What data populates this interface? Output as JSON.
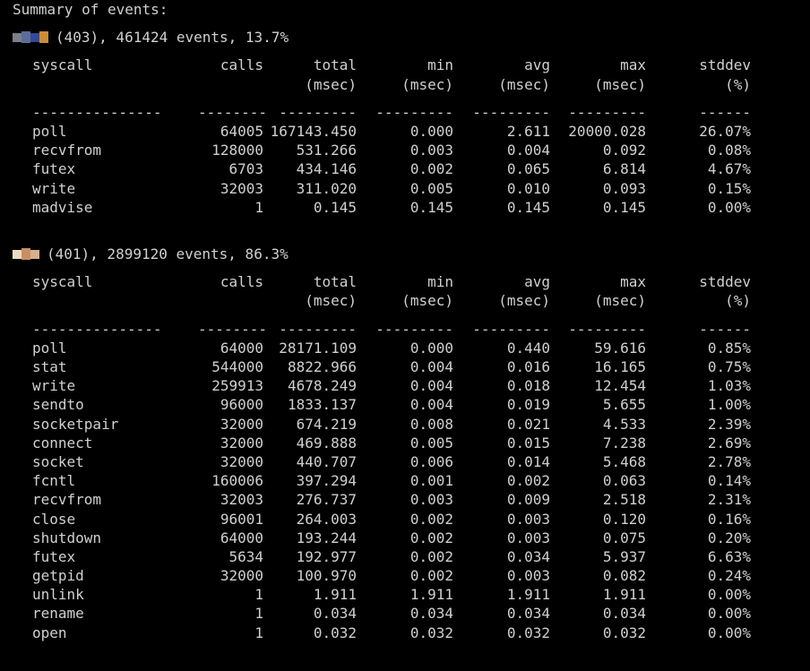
{
  "terminal": {
    "title_line": "Summary of events:",
    "processes": [
      {
        "pid_text": "(403), 461424 events, 13.7%",
        "censor_colors": [
          "#7a7f8c",
          "#5c6d97",
          "#33489a",
          "#c98d3c"
        ],
        "headers": {
          "syscall": "syscall",
          "calls": "calls",
          "total": "total",
          "total_unit": "(msec)",
          "min": "min",
          "min_unit": "(msec)",
          "avg": "avg",
          "avg_unit": "(msec)",
          "max": "max",
          "max_unit": "(msec)",
          "stddev": "stddev",
          "stddev_unit": "(%)"
        },
        "separators": [
          "---------------",
          "--------",
          "---------",
          "---------",
          "---------",
          "---------",
          "------"
        ],
        "rows": [
          [
            "poll",
            "64005",
            "167143.450",
            "0.000",
            "2.611",
            "20000.028",
            "26.07%"
          ],
          [
            "recvfrom",
            "128000",
            "531.266",
            "0.003",
            "0.004",
            "0.092",
            "0.08%"
          ],
          [
            "futex",
            "6703",
            "434.146",
            "0.002",
            "0.065",
            "6.814",
            "4.67%"
          ],
          [
            "write",
            "32003",
            "311.020",
            "0.005",
            "0.010",
            "0.093",
            "0.15%"
          ],
          [
            "madvise",
            "1",
            "0.145",
            "0.145",
            "0.145",
            "0.145",
            "0.00%"
          ]
        ]
      },
      {
        "pid_text": "(401), 2899120 events, 86.3%",
        "censor_colors": [
          "#e8ddc4",
          "#c88e66",
          "#d9b08e"
        ],
        "headers": {
          "syscall": "syscall",
          "calls": "calls",
          "total": "total",
          "total_unit": "(msec)",
          "min": "min",
          "min_unit": "(msec)",
          "avg": "avg",
          "avg_unit": "(msec)",
          "max": "max",
          "max_unit": "(msec)",
          "stddev": "stddev",
          "stddev_unit": "(%)"
        },
        "separators": [
          "---------------",
          "--------",
          "---------",
          "---------",
          "---------",
          "---------",
          "------"
        ],
        "rows": [
          [
            "poll",
            "64000",
            "28171.109",
            "0.000",
            "0.440",
            "59.616",
            "0.85%"
          ],
          [
            "stat",
            "544000",
            "8822.966",
            "0.004",
            "0.016",
            "16.165",
            "0.75%"
          ],
          [
            "write",
            "259913",
            "4678.249",
            "0.004",
            "0.018",
            "12.454",
            "1.03%"
          ],
          [
            "sendto",
            "96000",
            "1833.137",
            "0.004",
            "0.019",
            "5.655",
            "1.00%"
          ],
          [
            "socketpair",
            "32000",
            "674.219",
            "0.008",
            "0.021",
            "4.533",
            "2.39%"
          ],
          [
            "connect",
            "32000",
            "469.888",
            "0.005",
            "0.015",
            "7.238",
            "2.69%"
          ],
          [
            "socket",
            "32000",
            "440.707",
            "0.006",
            "0.014",
            "5.468",
            "2.78%"
          ],
          [
            "fcntl",
            "160006",
            "397.294",
            "0.001",
            "0.002",
            "0.063",
            "0.14%"
          ],
          [
            "recvfrom",
            "32003",
            "276.737",
            "0.003",
            "0.009",
            "2.518",
            "2.31%"
          ],
          [
            "close",
            "96001",
            "264.003",
            "0.002",
            "0.003",
            "0.120",
            "0.16%"
          ],
          [
            "shutdown",
            "64000",
            "193.244",
            "0.002",
            "0.003",
            "0.075",
            "0.20%"
          ],
          [
            "futex",
            "5634",
            "192.977",
            "0.002",
            "0.034",
            "5.937",
            "6.63%"
          ],
          [
            "getpid",
            "32000",
            "100.970",
            "0.002",
            "0.003",
            "0.082",
            "0.24%"
          ],
          [
            "unlink",
            "1",
            "1.911",
            "1.911",
            "1.911",
            "1.911",
            "0.00%"
          ],
          [
            "rename",
            "1",
            "0.034",
            "0.034",
            "0.034",
            "0.034",
            "0.00%"
          ],
          [
            "open",
            "1",
            "0.032",
            "0.032",
            "0.032",
            "0.032",
            "0.00%"
          ]
        ]
      }
    ]
  }
}
